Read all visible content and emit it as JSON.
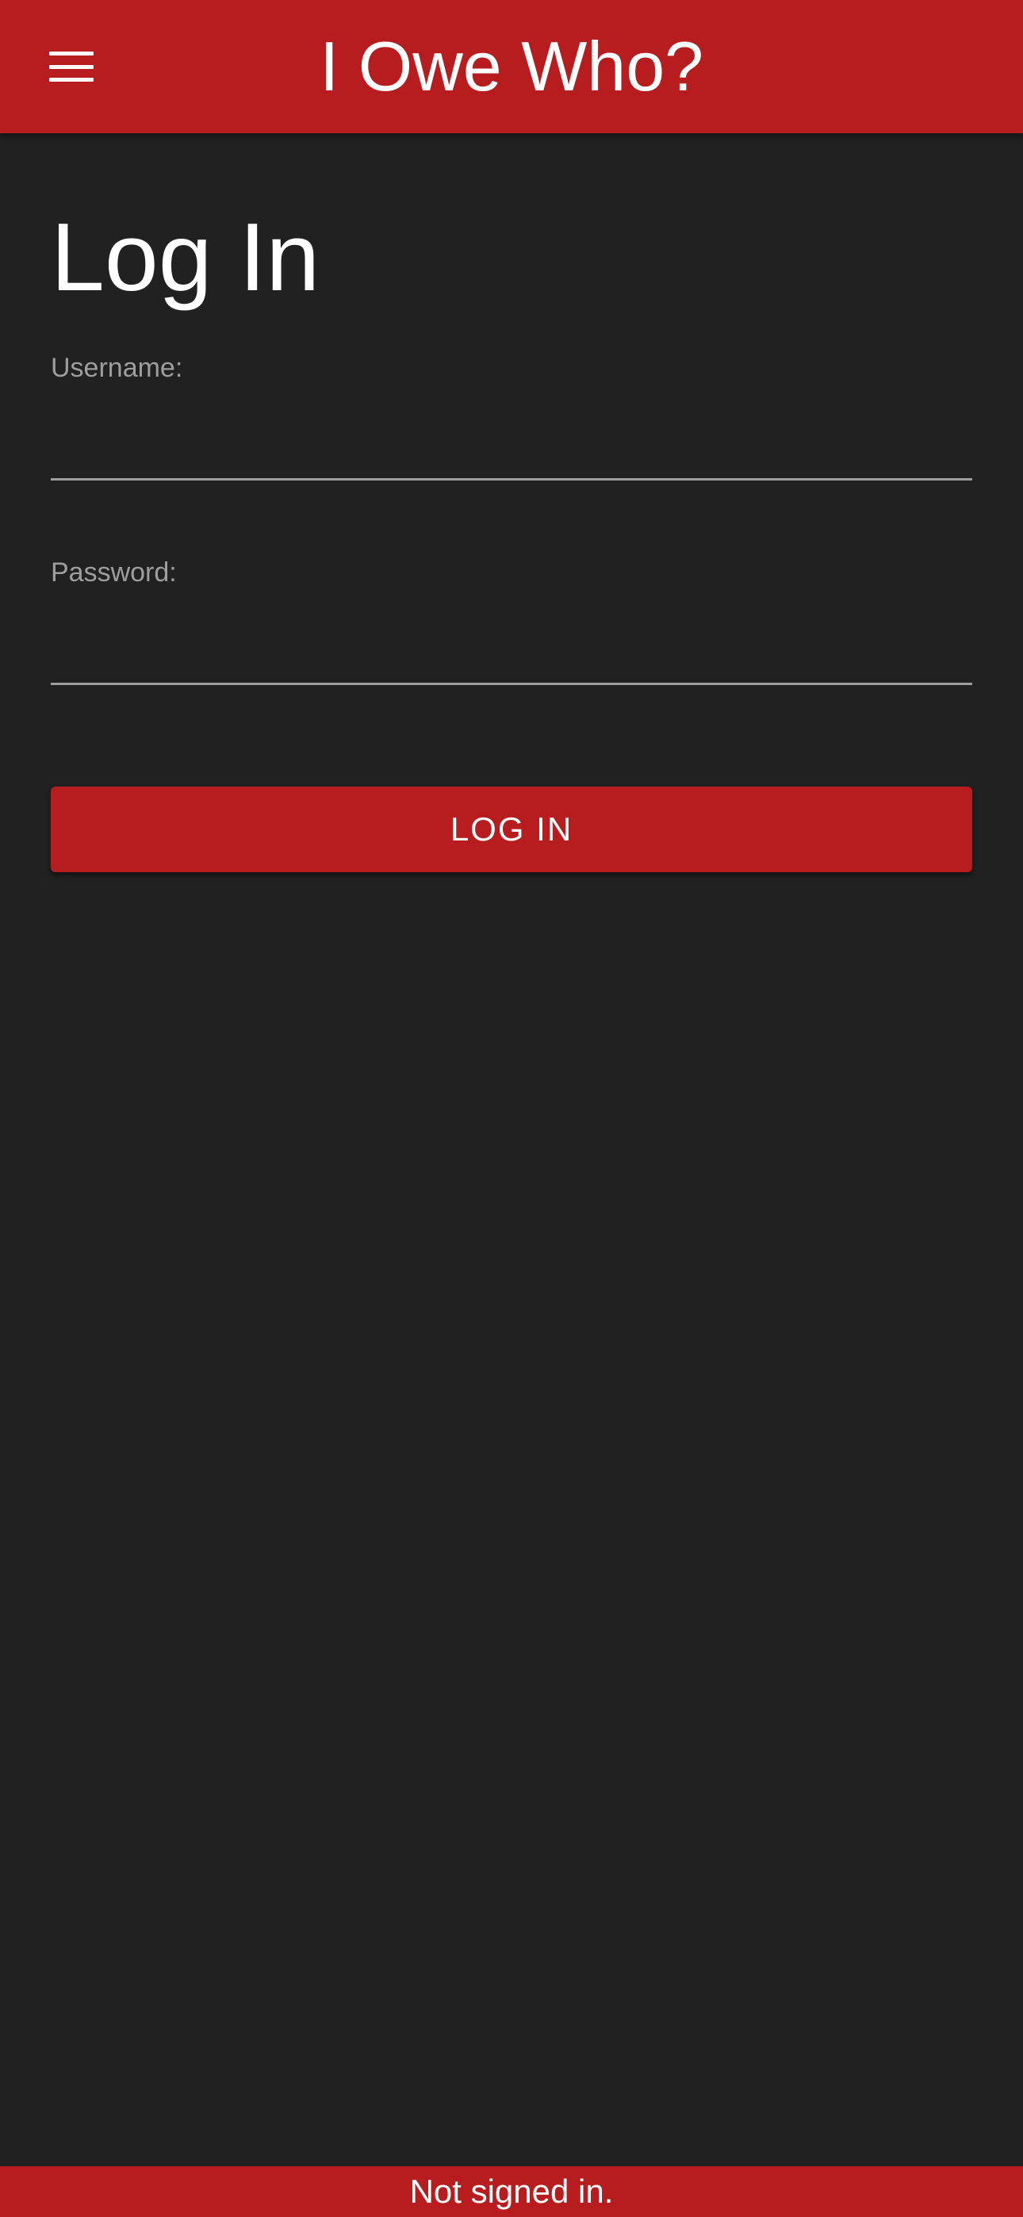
{
  "header": {
    "title": "I Owe Who?",
    "menu_icon": "hamburger-menu-icon",
    "background_color": "#b71c1f"
  },
  "login": {
    "page_title": "Log In",
    "username_label": "Username:",
    "username_value": "",
    "password_label": "Password:",
    "password_value": "",
    "submit_label": "LOG IN"
  },
  "footer": {
    "status_text": "Not signed in."
  },
  "theme": {
    "page_background": "#212121",
    "accent": "#b71c1f",
    "label_color": "#9e9e9e",
    "text_color": "#ffffff"
  }
}
